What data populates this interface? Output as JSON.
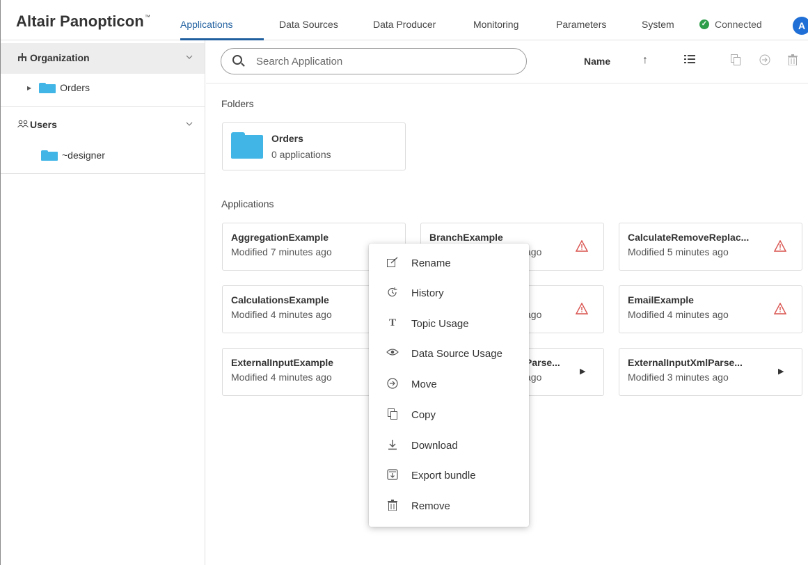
{
  "header": {
    "brand": "Altair Panopticon",
    "brand_mark": "™",
    "nav": [
      {
        "label": "Applications",
        "active": true
      },
      {
        "label": "Data Sources",
        "active": false
      },
      {
        "label": "Data Producer",
        "active": false
      },
      {
        "label": "Monitoring",
        "active": false
      },
      {
        "label": "Parameters",
        "active": false
      },
      {
        "label": "System",
        "active": false
      }
    ],
    "status": "Connected",
    "status_color": "#2e9e4a",
    "avatar_initial": "A",
    "accent": "#1f5f9f"
  },
  "sidebar": {
    "organization": {
      "label": "Organization",
      "icon": "org-tree-icon",
      "items": [
        {
          "label": "Orders",
          "icon": "folder-icon"
        }
      ]
    },
    "users": {
      "label": "Users",
      "icon": "users-icon",
      "items": [
        {
          "label": "~designer",
          "icon": "folder-icon"
        }
      ]
    }
  },
  "toolbar": {
    "search_placeholder": "Search Application",
    "sort_label": "Name",
    "icons": [
      "sort-asc-icon",
      "list-view-icon",
      "copy-icon",
      "move-icon",
      "delete-icon"
    ]
  },
  "main": {
    "folders_title": "Folders",
    "folders": [
      {
        "name": "Orders",
        "count": "0 applications"
      }
    ],
    "applications_title": "Applications",
    "applications": [
      {
        "name": "AggregationExample",
        "modified": "Modified 7 minutes ago",
        "status": "none"
      },
      {
        "name": "BranchExample",
        "modified": "ago",
        "status": "warning"
      },
      {
        "name": "CalculateRemoveReplac...",
        "modified": "Modified 5 minutes ago",
        "status": "warning"
      },
      {
        "name": "CalculationsExample",
        "modified": "Modified 4 minutes ago",
        "status": "none"
      },
      {
        "name": "",
        "modified": "ago",
        "status": "warning"
      },
      {
        "name": "EmailExample",
        "modified": "Modified 4 minutes ago",
        "status": "warning"
      },
      {
        "name": "ExternalInputExample",
        "modified": "Modified 4 minutes ago",
        "status": "none"
      },
      {
        "name": "Parse...",
        "modified": "ago",
        "status": "play"
      },
      {
        "name": "ExternalInputXmlParse...",
        "modified": "Modified 3 minutes ago",
        "status": "play"
      }
    ],
    "warning_color": "#d9534f"
  },
  "context_menu": {
    "items": [
      {
        "label": "Rename",
        "icon": "rename-icon"
      },
      {
        "label": "History",
        "icon": "history-icon"
      },
      {
        "label": "Topic Usage",
        "icon": "topic-usage-icon"
      },
      {
        "label": "Data Source Usage",
        "icon": "eye-icon"
      },
      {
        "label": "Move",
        "icon": "move-icon"
      },
      {
        "label": "Copy",
        "icon": "copy-icon"
      },
      {
        "label": "Download",
        "icon": "download-icon"
      },
      {
        "label": "Export bundle",
        "icon": "export-bundle-icon"
      },
      {
        "label": "Remove",
        "icon": "trash-icon"
      }
    ]
  }
}
